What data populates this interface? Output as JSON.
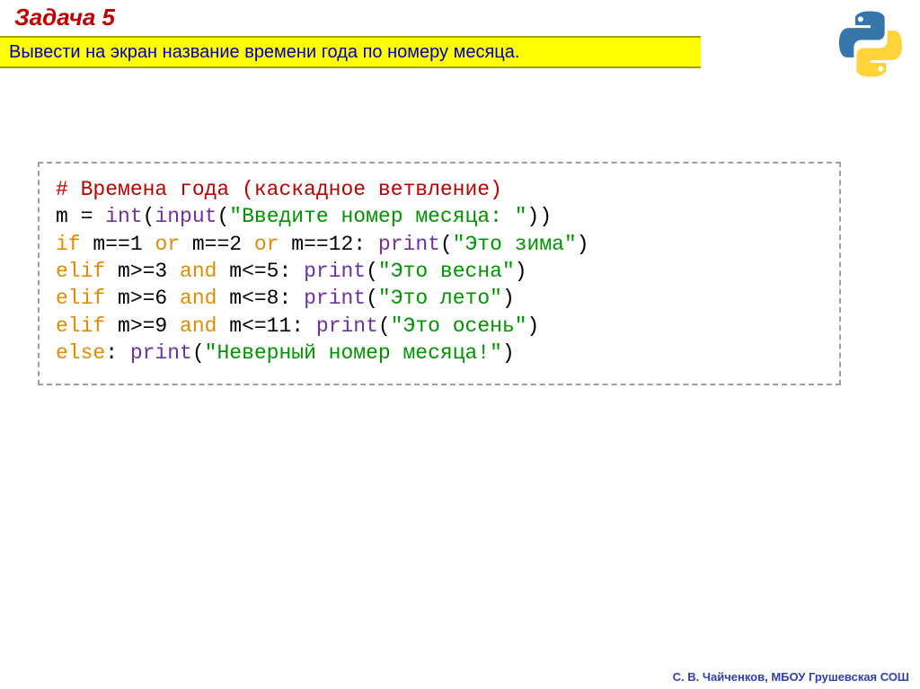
{
  "title": "Задача 5",
  "subtitle": "Вывести на экран название времени года по номеру месяца.",
  "code": {
    "comment": "# Времена года (каскадное ветвление)",
    "l2_var": "m = ",
    "l2_int": "int",
    "l2_p1": "(",
    "l2_input": "input",
    "l2_p2": "(",
    "l2_str": "\"Введите номер месяца: \"",
    "l2_p3": "))",
    "l3_if": "if",
    "l3_a": " m==1 ",
    "l3_or1": "or",
    "l3_b": " m==2 ",
    "l3_or2": "or",
    "l3_c": " m==12: ",
    "l3_print": "print",
    "l3_p1": "(",
    "l3_str": "\"Это зима\"",
    "l3_p2": ")",
    "l4_elif": "elif",
    "l4_a": " m>=3 ",
    "l4_and": "and",
    "l4_b": " m<=5: ",
    "l4_print": "print",
    "l4_p1": "(",
    "l4_str": "\"Это весна\"",
    "l4_p2": ")",
    "l5_elif": "elif",
    "l5_a": " m>=6 ",
    "l5_and": "and",
    "l5_b": " m<=8: ",
    "l5_print": "print",
    "l5_p1": "(",
    "l5_str": "\"Это лето\"",
    "l5_p2": ")",
    "l6_elif": "elif",
    "l6_a": " m>=9 ",
    "l6_and": "and",
    "l6_b": " m<=11: ",
    "l6_print": "print",
    "l6_p1": "(",
    "l6_str": "\"Это осень\"",
    "l6_p2": ")",
    "l7_else": "else",
    "l7_colon": ": ",
    "l7_print": "print",
    "l7_p1": "(",
    "l7_str": "\"Неверный номер месяца!\"",
    "l7_p2": ")"
  },
  "footer": "С. В. Чайченков, МБОУ Грушевская СОШ"
}
